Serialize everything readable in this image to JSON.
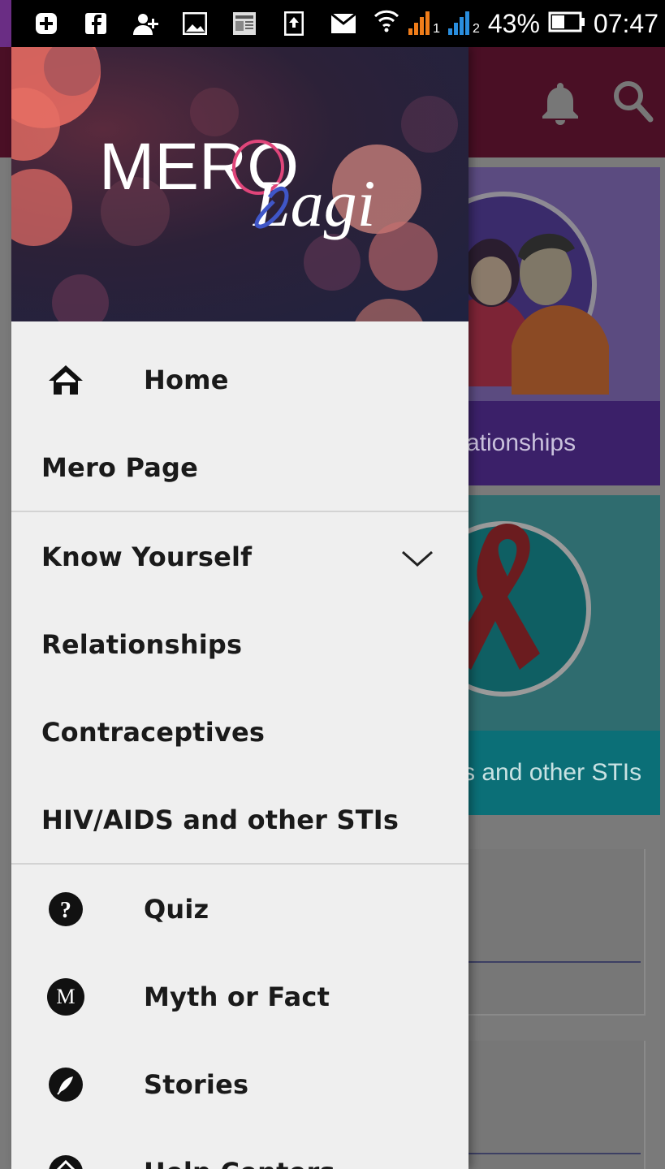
{
  "status_bar": {
    "battery": "43%",
    "time": "07:47",
    "sim1": "1",
    "sim2": "2"
  },
  "background": {
    "card1_label": "ationships",
    "card2_label": "s and other STIs"
  },
  "drawer": {
    "logo_primary": "MERO",
    "logo_secondary": "Lagi",
    "items": [
      {
        "label": "Home",
        "icon": "home-icon"
      },
      {
        "label": "Mero Page"
      },
      {
        "label": "Know Yourself",
        "icon": "chevron-down-icon"
      },
      {
        "label": "Relationships"
      },
      {
        "label": "Contraceptives"
      },
      {
        "label": "HIV/AIDS and other STIs"
      },
      {
        "label": "Quiz",
        "icon": "question-icon"
      },
      {
        "label": "Myth or Fact",
        "icon": "m-icon",
        "icon_letter": "M"
      },
      {
        "label": "Stories",
        "icon": "feather-icon"
      },
      {
        "label": "Help Centers",
        "icon": "location-icon"
      }
    ]
  },
  "colors": {
    "toolbar": "#4a0f25",
    "logo_accent": "#e0457a",
    "logo_script": "#3f56c8"
  }
}
